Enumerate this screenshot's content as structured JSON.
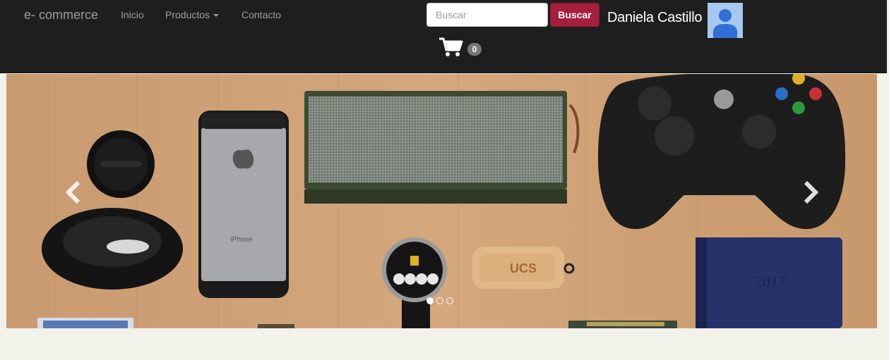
{
  "navbar": {
    "brand": "e- commerce",
    "links": [
      {
        "label": "Inicio"
      },
      {
        "label": "Productos",
        "has_dropdown": true
      },
      {
        "label": "Contacto"
      }
    ],
    "search": {
      "placeholder": "Buscar",
      "value": "",
      "button_label": "Buscar"
    },
    "user": {
      "name": "Daniela Castillo",
      "avatar_icon": "user-silhouette-icon"
    },
    "cart": {
      "icon": "shopping-cart-icon",
      "count": "0"
    }
  },
  "carousel": {
    "image_text": {
      "phone": "iPhone",
      "usb": "UCS",
      "notebook": "2017"
    },
    "prev_icon": "chevron-left-icon",
    "next_icon": "chevron-right-icon",
    "slide_count": 3,
    "active_slide": 1
  },
  "colors": {
    "navbar_bg": "#1e1e1e",
    "accent_button": "#a51e3b",
    "page_bg": "#f3f2ea",
    "avatar_bg": "#a8c8f0"
  }
}
